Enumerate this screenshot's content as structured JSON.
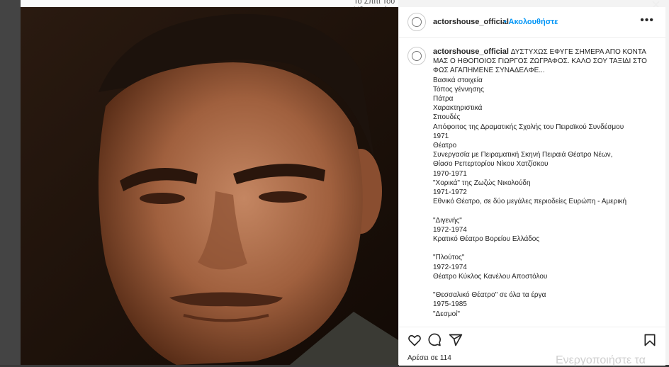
{
  "background": {
    "page_title": "Το Σπίτι Του Ηθοποιού",
    "close_symbol": "×",
    "watermark_text": "Ενεργοποιήστε τα"
  },
  "post": {
    "username": "actorshouse_official",
    "follow_separator": "•",
    "follow_label": "Ακολουθήστε",
    "more_label": "•••",
    "caption_lines": [
      "ΔΥΣΤΥΧΩΣ ΕΦΥΓΕ ΣΗΜΕΡΑ ΑΠΟ ΚΟΝΤΑ",
      "ΜΑΣ Ο ΗΘΟΠΟΙΟΣ ΓΙΩΡΓΟΣ ΖΩΓΡΑΦΟΣ. ΚΑΛΟ ΣΟΥ ΤΑΞΙΔΙ ΣΤΟ",
      "ΦΩΣ ΑΓΑΠΗΜΕΝΕ ΣΥΝΑΔΕΛΦΕ...",
      "Βασικά στοιχεία",
      "Τόπος γέννησης",
      "Πάτρα",
      "Χαρακτηριστικά",
      "Σπουδές",
      "Απόφοιτος της Δραματικής Σχολής του Πειραϊκού Συνδέσμου",
      "1971",
      "Θέατρο",
      "Συνεργασία με Πειραματική Σκηνή Πειραιά Θέατρο Νέων,",
      "Θίασο Ρεπερτορίου Νίκου Χατζίσκου",
      "1970-1971",
      "\"Χορικά\" της Ζωζώς Νικολούδη",
      "1971-1972",
      "Εθνικό Θέατρο, σε δύο μεγάλες περιοδείες Ευρώπη - Αμερική",
      "",
      "\"Διγενής\"",
      "1972-1974",
      "Κρατικό Θέατρο Βορείου Ελλάδος",
      "",
      "\"Πλούτος\"",
      "1972-1974",
      "Θέατρο Κύκλος Κανέλου Αποστόλου",
      "",
      "\"Θεσσαλικό Θέατρο\" σε όλα τα έργα",
      "1975-1985",
      "\"Δεσμοί\""
    ],
    "likes_text": "Αρέσει σε 114",
    "icons": [
      "heart-icon",
      "comment-icon",
      "share-icon",
      "bookmark-icon"
    ]
  }
}
